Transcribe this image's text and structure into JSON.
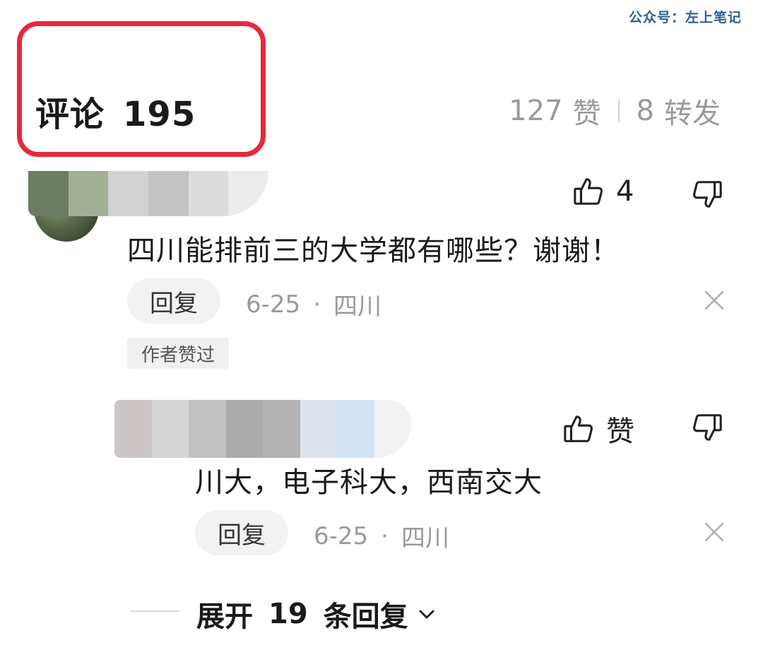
{
  "watermark": "公众号：左上笔记",
  "header": {
    "title": "评论",
    "count": "195",
    "likes": "127",
    "likes_unit": "赞",
    "shares": "8",
    "shares_unit": "转发"
  },
  "comments": [
    {
      "text": "四川能排前三的大学都有哪些？谢谢！",
      "like_count": "4",
      "reply_label": "回复",
      "date": "6-25",
      "separator": "·",
      "location": "四川",
      "tag": "作者赞过"
    },
    {
      "text": "川大，电子科大，西南交大",
      "like_label": "赞",
      "reply_label": "回复",
      "date": "6-25",
      "separator": "·",
      "location": "四川"
    }
  ],
  "expand": {
    "prefix": "展开",
    "count": "19",
    "suffix": "条回复"
  },
  "colors": {
    "highlight": "#e8283c",
    "watermark": "#2f5f8f",
    "muted_text": "#9a9a9a"
  },
  "icons": [
    "thumbs-up-icon",
    "thumbs-down-icon",
    "close-icon",
    "chevron-down-icon"
  ]
}
